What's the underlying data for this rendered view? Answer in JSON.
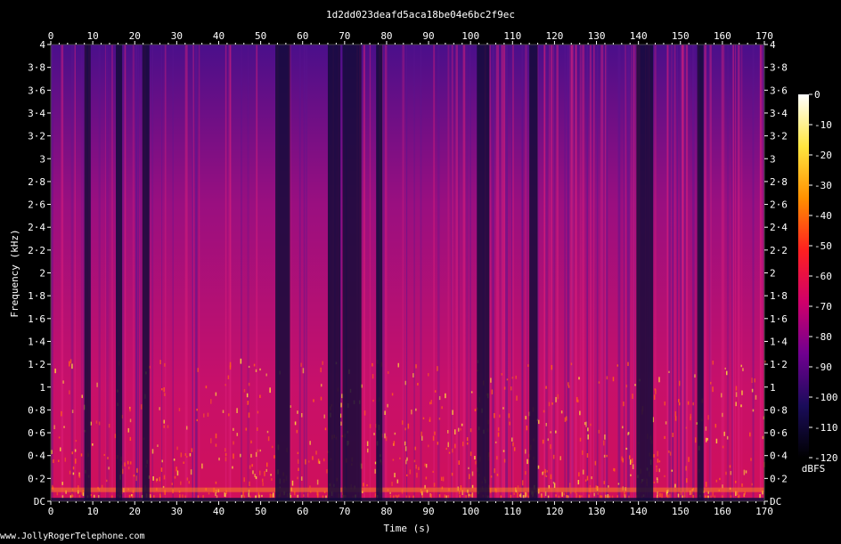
{
  "chart_data": {
    "type": "heatmap",
    "title": "1d2dd023deafd5aca18be04e6bc2f9ec",
    "xlabel": "Time (s)",
    "ylabel": "Frequency (kHz)",
    "xlim": [
      0,
      170
    ],
    "ylim": [
      0,
      4
    ],
    "x_ticks": [
      "0",
      "10",
      "20",
      "30",
      "40",
      "50",
      "60",
      "70",
      "80",
      "90",
      "100",
      "110",
      "120",
      "130",
      "140",
      "150",
      "160",
      "170"
    ],
    "y_ticks": [
      "DC",
      "0·2",
      "0·4",
      "0·6",
      "0·8",
      "1",
      "1·2",
      "1·4",
      "1·6",
      "1·8",
      "2",
      "2·2",
      "2·4",
      "2·6",
      "2·8",
      "3",
      "3·2",
      "3·4",
      "3·6",
      "3·8",
      "4"
    ],
    "colorbar": {
      "label": "dBFS",
      "ticks": [
        "0",
        "-10",
        "-20",
        "-30",
        "-40",
        "-50",
        "-60",
        "-70",
        "-80",
        "-90",
        "-100",
        "-110",
        "-120"
      ],
      "range": [
        -120,
        0
      ],
      "colormap": [
        "#ffffff",
        "#ffe640",
        "#ff9000",
        "#ff2020",
        "#d0006a",
        "#700090",
        "#1a0c5a",
        "#000000"
      ]
    },
    "quiet_intervals_s": [
      [
        8,
        9.5
      ],
      [
        15.5,
        17
      ],
      [
        21.8,
        23.5
      ],
      [
        53.5,
        57
      ],
      [
        66,
        69
      ],
      [
        69.5,
        74
      ],
      [
        77.5,
        79
      ],
      [
        101.5,
        104.5
      ],
      [
        114,
        116
      ],
      [
        139.5,
        143.5
      ],
      [
        154,
        155.5
      ]
    ],
    "energy_band_khz": [
      0.08,
      0.12
    ]
  },
  "footer": {
    "credit": "www.JollyRogerTelephone.com"
  }
}
